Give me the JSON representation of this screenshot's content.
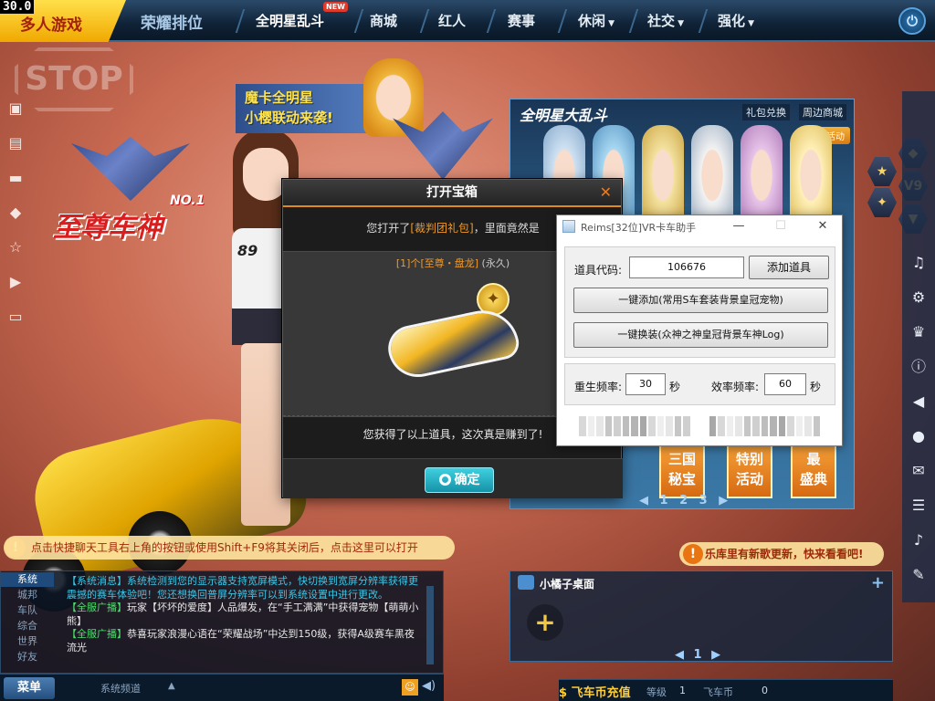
{
  "fps": "30.0",
  "nav": {
    "multiplayer": "多人游戏",
    "ranked": "荣耀排位",
    "allstar": "全明星乱斗",
    "allstar_badge": "NEW",
    "mall": "商城",
    "red": "红人",
    "events": "赛事",
    "leisure": "休闲",
    "social": "社交",
    "enhance": "强化"
  },
  "backdrop": {
    "stop": "STOP",
    "zhizun_logo": "至尊车神",
    "zhizun_no1": "NO.1",
    "promo_line1": "魔卡全明星",
    "promo_line2": "小樱联动来袭!",
    "allstar_panel_title": "全明星大乱斗",
    "gift_exchange": "礼包兑换",
    "nearby_mall": "周边商城",
    "more_info": "更多活动",
    "tiles": [
      "三国\n秘宝",
      "特别\n活动",
      "最\n盛典"
    ],
    "pager": "◀ 1 2 3 ▶",
    "girl_number": "89"
  },
  "tip_bar": "点击快捷聊天工具右上角的按钮或使用Shift+F9将其关闭后，点击这里可以打开",
  "music_bar": "乐库里有新歌更新，快来看看吧!",
  "chat": {
    "tabs": [
      "系统",
      "城邦",
      "车队",
      "综合",
      "世界",
      "好友"
    ],
    "lines": [
      {
        "tag": "【系统消息】",
        "text": "系统检测到您的显示器支持宽屏模式，快切换到宽屏分辨率获得更震撼的赛车体验吧！您还想换回普屏分辨率可以到系统设置中进行更改。"
      },
      {
        "tag": "【全服广播】",
        "text": "玩家【坏坏的爱度】人品爆发，在“手工满满”中获得宠物【萌萌小熊】"
      },
      {
        "tag": "【全服广播】",
        "text": "恭喜玩家浪漫心语在“荣耀战场”中达到150级，获得A级赛车黑夜流光"
      }
    ],
    "menu": "菜单",
    "channel": "系统频道"
  },
  "pet": {
    "title": "小橘子桌面",
    "pager": "◀ 1 ▶"
  },
  "currency": {
    "recharge": "飞车币充值",
    "level_label": "等级",
    "level_value": "1",
    "coin_label": "飞车币",
    "coin_value": "0"
  },
  "chest": {
    "title": "打开宝箱",
    "close": "✕",
    "msg_prefix": "您打开了",
    "msg_pack": "[裁判团礼包]",
    "msg_suffix": "，里面竟然是",
    "item_count": "[1]个",
    "item_name": "[至尊・盘龙]",
    "item_duration": "(永久)",
    "got": "您获得了以上道具，这次真是赚到了!",
    "confirm": "确定"
  },
  "helper": {
    "title": "Reims[32位]VR卡车助手",
    "minimize": "—",
    "maximize": "☐",
    "close": "✕",
    "item_code_label": "道具代码:",
    "item_code_value": "106676",
    "add_item": "添加道具",
    "one_click_add": "一键添加(常用S车套装背景皇冠宠物)",
    "one_click_swap": "一键换装(众神之神皇冠背景车神Log)",
    "respawn_label": "重生频率:",
    "respawn_value": "30",
    "respawn_unit": "秒",
    "efficiency_label": "效率频率:",
    "efficiency_value": "60",
    "efficiency_unit": "秒"
  },
  "colors": {
    "accent_orange": "#e08a1e",
    "confirm_cyan": "#1fb2c6",
    "nav_bg": "#0f2236"
  }
}
